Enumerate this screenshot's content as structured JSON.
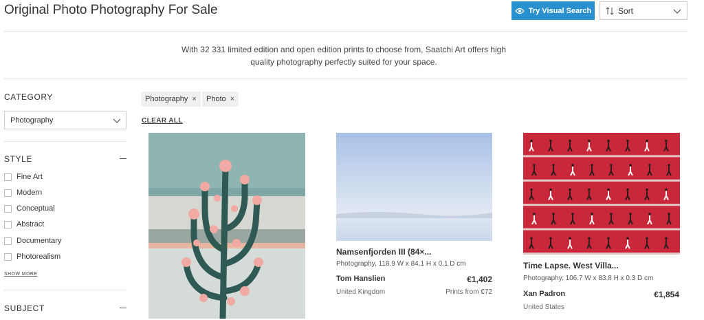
{
  "header": {
    "title": "Original Photo Photography For Sale",
    "visual_search_label": "Try Visual Search",
    "sort_label": "Sort"
  },
  "intro": {
    "line1": "With 32 331 limited edition and open edition prints to choose from, Saatchi Art offers high",
    "line2": "quality photography perfectly suited for your space."
  },
  "sidebar": {
    "category_heading": "CATEGORY",
    "category_value": "Photography",
    "style_heading": "STYLE",
    "style_options": [
      "Fine Art",
      "Modern",
      "Conceptual",
      "Abstract",
      "Documentary",
      "Photorealism"
    ],
    "show_more": "SHOW MORE",
    "subject_heading": "SUBJECT"
  },
  "filters": {
    "chips": [
      "Photography",
      "Photo"
    ],
    "clear_all": "CLEAR ALL"
  },
  "artworks": [
    {
      "title": "",
      "desc": "",
      "artist": "",
      "price": "",
      "location": "",
      "prints": ""
    },
    {
      "title": "Namsenfjorden III (84×...",
      "desc": "Photography, 118.9 W x 84.1 H x 0.1 D cm",
      "artist": "Tom Hanslien",
      "price": "€1,402",
      "location": "United Kingdom",
      "prints": "Prints from €72"
    },
    {
      "title": "Time Lapse. West Villa...",
      "desc": "Photography, 106.7 W x 83.8 H x 0.3 D cm",
      "artist": "Xan Padron",
      "price": "€1,854",
      "location": "United States",
      "prints": ""
    }
  ],
  "colors": {
    "accent": "#2b90d0",
    "chip_bg": "#f0f0f0",
    "time_lapse_red": "#c8283a"
  }
}
